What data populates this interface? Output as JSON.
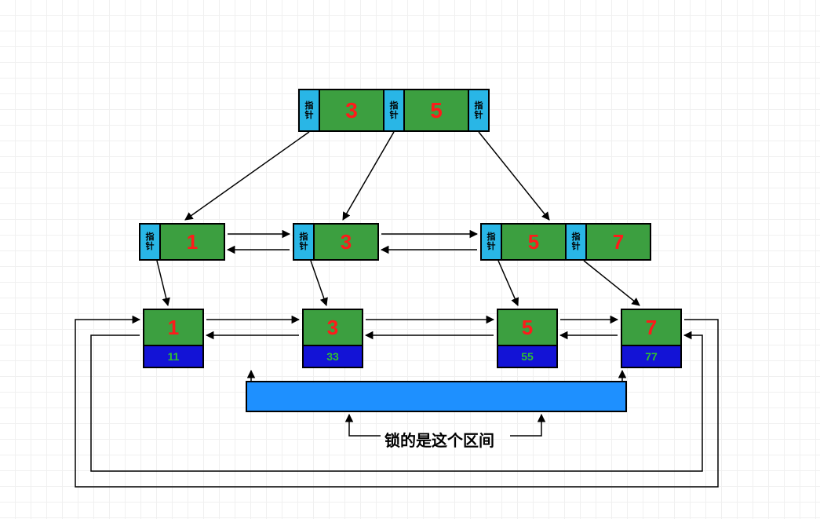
{
  "pointer_label": "指\n针",
  "root": {
    "keys": [
      "3",
      "5"
    ]
  },
  "level2": [
    {
      "keys": [
        "1"
      ]
    },
    {
      "keys": [
        "3"
      ]
    },
    {
      "keys": [
        "5",
        "7"
      ]
    }
  ],
  "leaves": [
    {
      "key": "1",
      "value": "11"
    },
    {
      "key": "3",
      "value": "33"
    },
    {
      "key": "5",
      "value": "55"
    },
    {
      "key": "7",
      "value": "77"
    }
  ],
  "lock_caption": "锁的是这个区间",
  "colors": {
    "pointer": "#29b6e6",
    "key_bg": "#3c9f40",
    "key_fg": "#ff1a1a",
    "value_bg": "#1313d6",
    "value_fg": "#2ec22e",
    "lock_bar": "#1e90ff"
  }
}
